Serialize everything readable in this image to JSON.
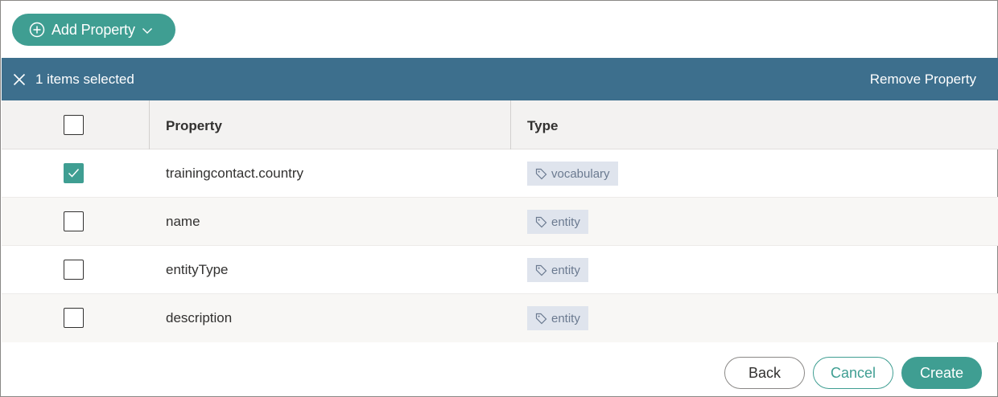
{
  "toolbar": {
    "add_property_label": "Add Property"
  },
  "selection_bar": {
    "count_label": "1 items selected",
    "remove_label": "Remove Property"
  },
  "table": {
    "columns": [
      "Property",
      "Type"
    ],
    "rows": [
      {
        "property": "trainingcontact.country",
        "type": "vocabulary",
        "checked": true
      },
      {
        "property": "name",
        "type": "entity",
        "checked": false
      },
      {
        "property": "entityType",
        "type": "entity",
        "checked": false
      },
      {
        "property": "description",
        "type": "entity",
        "checked": false
      }
    ]
  },
  "footer": {
    "back_label": "Back",
    "cancel_label": "Cancel",
    "create_label": "Create"
  },
  "colors": {
    "accent": "#3f9e92",
    "selection_bar": "#3d6f8d",
    "tag_bg": "#dfe4ed",
    "tag_text": "#6b7a90"
  },
  "icons": {
    "add": "plus-circle-icon",
    "dropdown": "chevron-down-icon",
    "close": "close-icon",
    "tag": "tag-icon",
    "check": "checkmark-icon"
  }
}
